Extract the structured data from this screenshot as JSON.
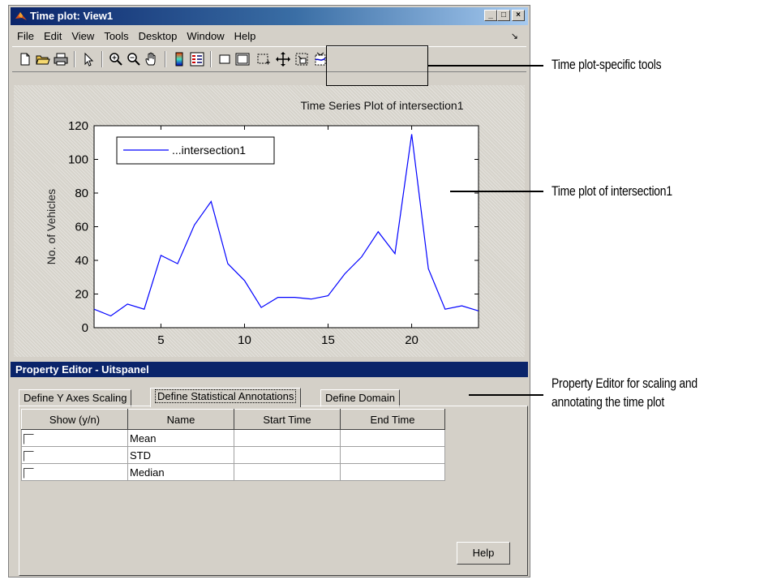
{
  "window": {
    "title": "Time plot: View1",
    "controls": [
      "minimize-icon",
      "maximize-icon",
      "close-icon"
    ]
  },
  "menu": [
    "File",
    "Edit",
    "View",
    "Tools",
    "Desktop",
    "Window",
    "Help"
  ],
  "toolbar": {
    "icons": [
      "new-file-icon",
      "open-folder-icon",
      "print-icon",
      "pointer-icon",
      "zoom-in-icon",
      "zoom-out-icon",
      "pan-hand-icon",
      "colorbar-icon",
      "legend-icon",
      "single-panel-icon",
      "full-panel-icon",
      "select-region-icon",
      "move-icon",
      "zoom-region-icon",
      "merge-icon"
    ]
  },
  "chart_data": {
    "type": "line",
    "title": "Time Series Plot of intersection1",
    "xlabel": "",
    "ylabel": "No. of Vehicles",
    "xlim": [
      1,
      24
    ],
    "ylim": [
      0,
      120
    ],
    "xticks": [
      5,
      10,
      15,
      20
    ],
    "yticks": [
      0,
      20,
      40,
      60,
      80,
      100,
      120
    ],
    "grid": false,
    "legend_position": "top-left",
    "series": [
      {
        "name": "...intersection1",
        "color": "#0000ff",
        "x": [
          1,
          2,
          3,
          4,
          5,
          6,
          7,
          8,
          9,
          10,
          11,
          12,
          13,
          14,
          15,
          16,
          17,
          18,
          19,
          20,
          21,
          22,
          23,
          24
        ],
        "values": [
          11,
          7,
          14,
          11,
          43,
          38,
          61,
          75,
          38,
          28,
          12,
          18,
          18,
          17,
          19,
          32,
          42,
          57,
          44,
          115,
          35,
          11,
          13,
          10
        ]
      }
    ]
  },
  "property_editor": {
    "title": "Property Editor - Uitspanel",
    "tabs": [
      "Define Y Axes Scaling",
      "Define Statistical Annotations",
      "Define Domain"
    ],
    "active_tab": "Define Statistical Annotations",
    "columns": [
      "Show (y/n)",
      "Name",
      "Start Time",
      "End Time"
    ],
    "rows": [
      {
        "show": false,
        "name": "Mean",
        "start": "",
        "end": ""
      },
      {
        "show": false,
        "name": "STD",
        "start": "",
        "end": ""
      },
      {
        "show": false,
        "name": "Median",
        "start": "",
        "end": ""
      }
    ],
    "help_label": "Help"
  },
  "callouts": {
    "tools": "Time plot-specific tools",
    "plot": "Time plot of intersection1",
    "editor_line1": "Property Editor for scaling and",
    "editor_line2": "annotating the time plot"
  }
}
